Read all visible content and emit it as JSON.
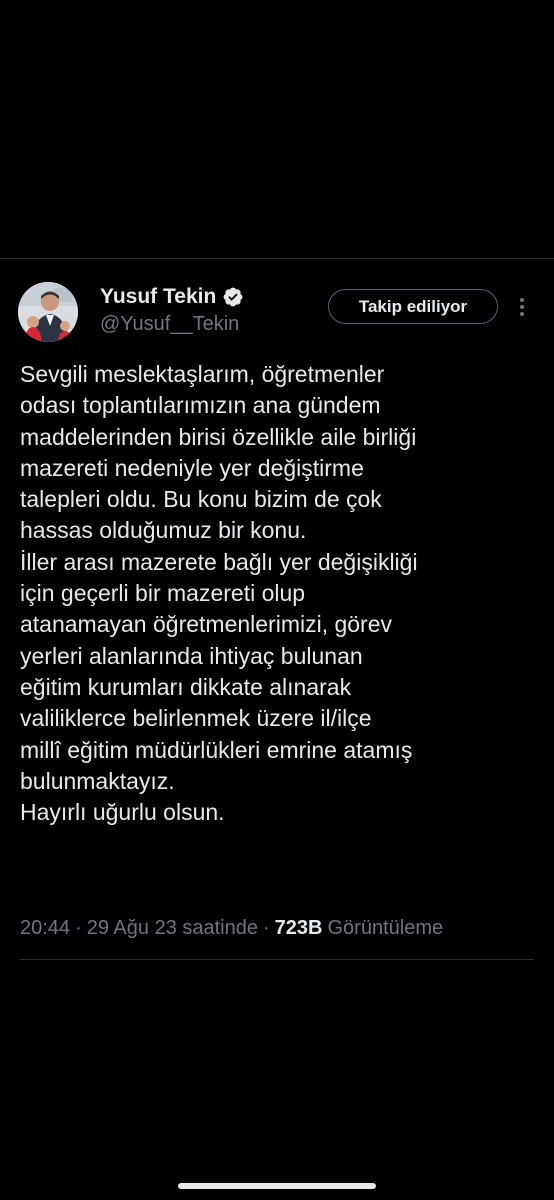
{
  "tweet": {
    "author": {
      "display_name": "Yusuf Tekin",
      "handle": "@Yusuf__Tekin",
      "verified": true,
      "verified_icon": "verified-badge-icon",
      "avatar_icon": "avatar"
    },
    "follow_button_label": "Takip ediliyor",
    "more_icon": "more-vertical-icon",
    "text_lines": [
      "Sevgili meslektaşlarım, öğretmenler",
      "odası toplantılarımızın ana gündem",
      "maddelerinden birisi özellikle aile birliği",
      "mazereti nedeniyle yer değiştirme",
      "talepleri oldu. Bu konu bizim de çok",
      "hassas olduğumuz bir konu.",
      "İller arası mazerete bağlı yer değişikliği",
      "için geçerli bir mazereti olup",
      "atanamayan öğretmenlerimizi, görev",
      "yerleri alanlarında ihtiyaç bulunan",
      "eğitim kurumları dikkate alınarak",
      "valiliklerce belirlenmek üzere il/ilçe",
      "millî eğitim müdürlükleri emrine atamış",
      "bulunmaktayız.",
      "Hayırlı uğurlu olsun."
    ],
    "meta": {
      "time": "20:44",
      "separator": "·",
      "date": "29 Ağu 23 saatinde",
      "views_count": "723B",
      "views_label": "Görüntüleme"
    }
  },
  "colors": {
    "background": "#000000",
    "text_primary": "#e7e9ea",
    "text_secondary": "#71767b",
    "divider": "#2a2d31",
    "follow_button_border": "#536471"
  }
}
